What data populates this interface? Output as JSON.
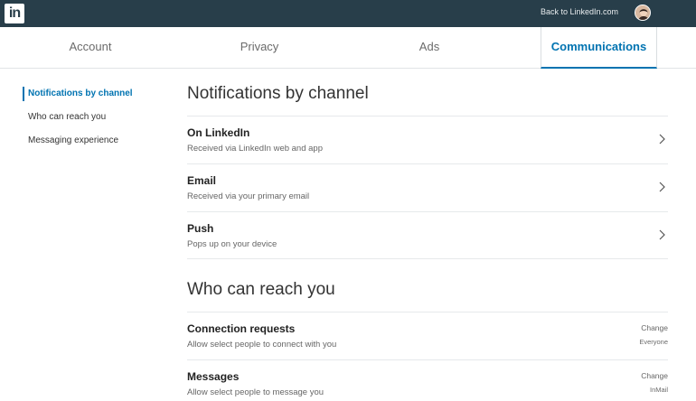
{
  "topbar": {
    "logo_text": "in",
    "back_link": "Back to LinkedIn.com",
    "avatar_icon": "user-avatar",
    "bg_color": "#283e4a"
  },
  "tabs": [
    {
      "label": "Account"
    },
    {
      "label": "Privacy"
    },
    {
      "label": "Ads"
    },
    {
      "label": "Communications",
      "active": true
    }
  ],
  "sidebar": {
    "items": [
      {
        "label": "Notifications by channel",
        "active": true
      },
      {
        "label": "Who can reach you"
      },
      {
        "label": "Messaging experience"
      }
    ]
  },
  "notifications": {
    "title": "Notifications by channel",
    "rows": [
      {
        "title": "On LinkedIn",
        "subtitle": "Received via LinkedIn web and app",
        "icon": "chevron-right-icon"
      },
      {
        "title": "Email",
        "subtitle": "Received via your primary email",
        "icon": "chevron-right-icon"
      },
      {
        "title": "Push",
        "subtitle": "Pops up on your device",
        "icon": "chevron-right-icon"
      }
    ]
  },
  "reach": {
    "title": "Who can reach you",
    "rows": [
      {
        "title": "Connection requests",
        "subtitle": "Allow select people to connect with you",
        "action": "Change",
        "value": "Everyone"
      },
      {
        "title": "Messages",
        "subtitle": "Allow select people to message you",
        "action": "Change",
        "value": "InMail"
      }
    ]
  },
  "colors": {
    "accent": "#0073b1",
    "text": "#333333",
    "muted": "#666666",
    "divider": "#e6e9eb"
  }
}
